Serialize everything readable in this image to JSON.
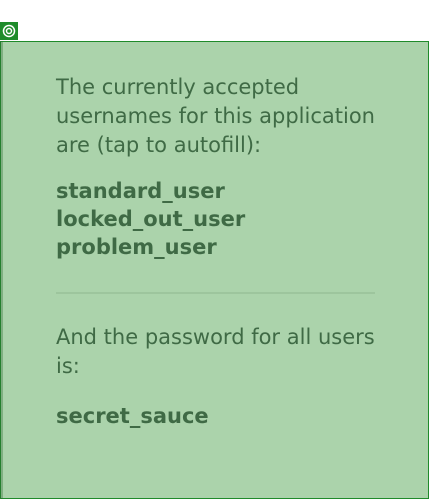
{
  "icons": {
    "corner": "target-icon"
  },
  "login_hint": {
    "usernames_intro": "The currently accepted usernames for this application are (tap to autofill):",
    "usernames": [
      "standard_user",
      "locked_out_user",
      "problem_user"
    ],
    "password_intro": "And the password for all users is:",
    "password": "secret_sauce"
  },
  "colors": {
    "panel_bg": "#abd3ab",
    "panel_border": "#1f8a2b",
    "text": "#3f6a45"
  }
}
